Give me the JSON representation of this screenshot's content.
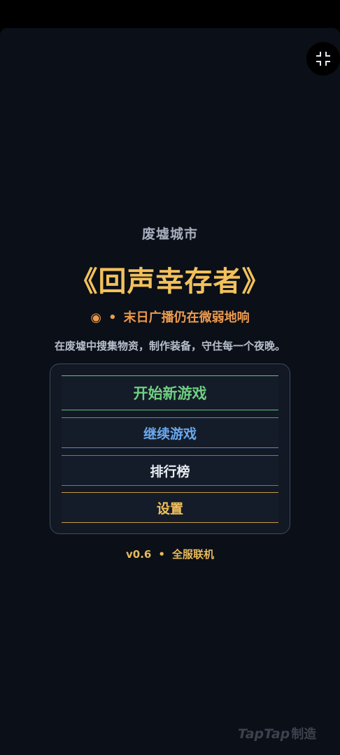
{
  "header": {
    "subtitle": "废墟城市",
    "title": "《回声幸存者》",
    "broadcast_icon": "◉",
    "broadcast_separator": "•",
    "broadcast_text": "末日广播仍在微弱地响",
    "description": "在废墟中搜集物资，制作装备，守住每一个夜晚。"
  },
  "menu": {
    "new_game": "开始新游戏",
    "continue": "继续游戏",
    "leaderboard": "排行榜",
    "settings": "设置"
  },
  "footer": {
    "version": "v0.6",
    "separator": "•",
    "mode": "全服联机"
  },
  "watermark": {
    "brand": "TapTap",
    "suffix": "制造"
  },
  "icons": {
    "collapse": "collapse-icon"
  },
  "colors": {
    "background": "#0b0f17",
    "title": "#f2c15c",
    "broadcast": "#ec9a4e",
    "new_game": "#6fcf83",
    "continue": "#6aa9ee",
    "leaderboard": "#e8ecf2",
    "settings": "#f2c15c"
  }
}
